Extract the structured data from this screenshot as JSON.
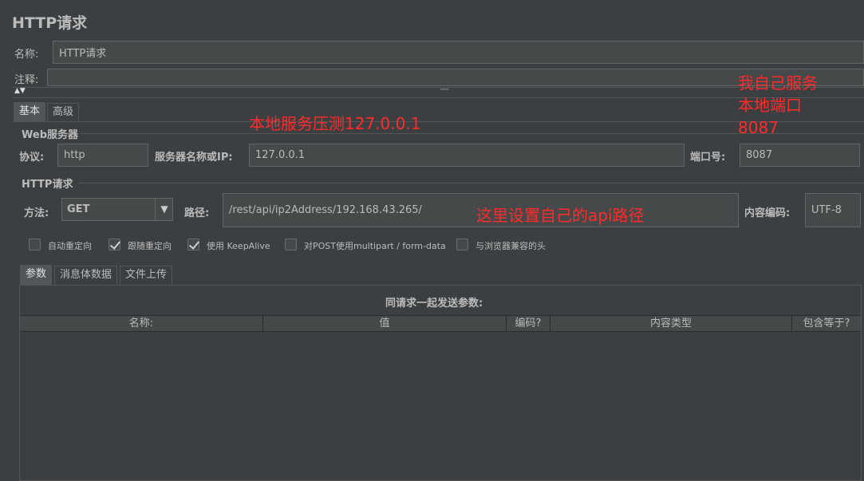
{
  "page_title": "HTTP请求",
  "name": {
    "label": "名称:",
    "value": "HTTP请求"
  },
  "comment": {
    "label": "注释:",
    "value": ""
  },
  "tabs_main": [
    "基本",
    "高级"
  ],
  "web_server": {
    "legend": "Web服务器",
    "protocol_label": "协议:",
    "protocol_value": "http",
    "server_label": "服务器名称或IP:",
    "server_value": "127.0.0.1",
    "port_label": "端口号:",
    "port_value": "8087"
  },
  "http_request": {
    "legend": "HTTP请求",
    "method_label": "方法:",
    "method_value": "GET",
    "path_label": "路径:",
    "path_value": "/rest/api/ip2Address/192.168.43.265/",
    "encoding_label": "内容编码:",
    "encoding_value": "UTF-8"
  },
  "options": [
    {
      "label": "自动重定向",
      "checked": false
    },
    {
      "label": "跟随重定向",
      "checked": true
    },
    {
      "label": "使用 KeepAlive",
      "checked": true
    },
    {
      "label": "对POST使用multipart / form-data",
      "checked": false
    },
    {
      "label": "与浏览器兼容的头",
      "checked": false
    }
  ],
  "tabs_params": [
    "参数",
    "消息体数据",
    "文件上传"
  ],
  "params_caption": "同请求一起发送参数:",
  "table_headers": [
    "名称:",
    "值",
    "编码?",
    "内容类型",
    "包含等于?"
  ],
  "annotations": {
    "local_service": "本地服务压测127.0.0.1",
    "my_service": "我自己服务",
    "local_port": "本地端口",
    "port_num": "8087",
    "api_path": "这里设置自己的api路径"
  },
  "colors": {
    "annotation": "#ff2a2a",
    "background": "#3c3f41"
  }
}
